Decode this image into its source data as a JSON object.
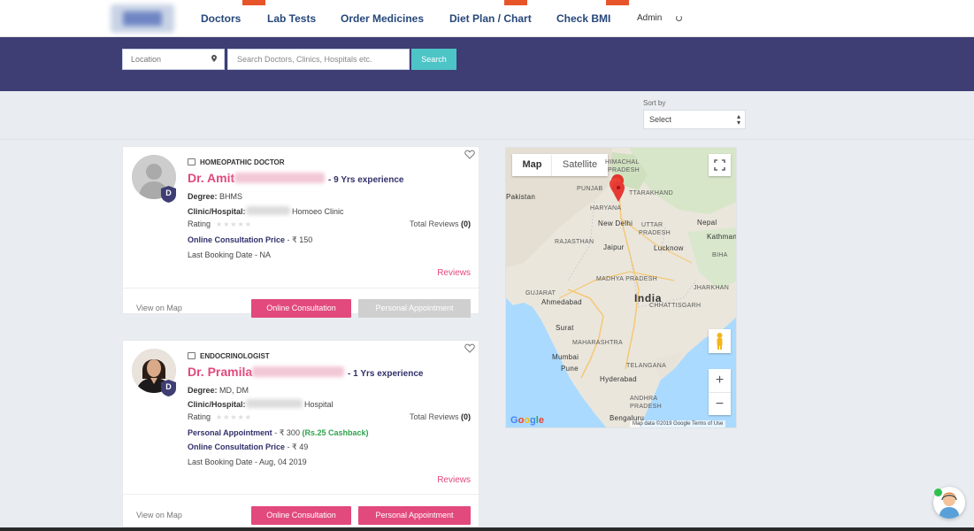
{
  "nav": {
    "links": [
      "Doctors",
      "Lab Tests",
      "Order Medicines",
      "Diet Plan / Chart",
      "Check BMI"
    ],
    "user_label": "Admin"
  },
  "search": {
    "location_placeholder": "Location",
    "query_placeholder": "Search Doctors, Clinics, Hospitals etc.",
    "button_label": "Search"
  },
  "sort": {
    "label": "Sort by",
    "selected": "Select"
  },
  "doctors": [
    {
      "specialty": "HOMEOPATHIC DOCTOR",
      "name_first": "Dr. Amit",
      "experience": "- 9 Yrs experience",
      "degree_label": "Degree:",
      "degree": "BHMS",
      "clinic_label": "Clinic/Hospital:",
      "clinic": "Homoeo Clinic",
      "rating_label": "Rating",
      "total_reviews_label": "Total Reviews",
      "total_reviews": "(0)",
      "online_price_label": "Online Consultation Price",
      "online_price": "- ₹ 150",
      "last_booking": "Last Booking Date - NA",
      "reviews_link": "Reviews",
      "view_map": "View on Map",
      "btn_online": "Online Consultation",
      "btn_personal": "Personal Appointment"
    },
    {
      "specialty": "ENDOCRINOLOGIST",
      "name_first": "Dr. Pramila",
      "experience": "- 1 Yrs experience",
      "degree_label": "Degree:",
      "degree": "MD, DM",
      "clinic_label": "Clinic/Hospital:",
      "clinic": "Hospital",
      "rating_label": "Rating",
      "total_reviews_label": "Total Reviews",
      "total_reviews": "(0)",
      "personal_label": "Personal Appointment",
      "personal_price": "- ₹ 300",
      "cashback": "(Rs.25 Cashback)",
      "online_price_label": "Online Consultation Price",
      "online_price": "- ₹ 49",
      "last_booking": "Last Booking Date - Aug, 04 2019",
      "reviews_link": "Reviews",
      "view_map": "View on Map",
      "btn_online": "Online Consultation",
      "btn_personal": "Personal Appointment"
    }
  ],
  "map": {
    "tab_map": "Map",
    "tab_satellite": "Satellite",
    "labels": {
      "pakistan": "Pakistan",
      "punjab": "PUNJAB",
      "himachal": "HIMACHAL",
      "pradesh1": "PRADESH",
      "uttarakhand": "TTARAKHAND",
      "haryana": "HARYANA",
      "new_delhi": "New Delhi",
      "nepal": "Nepal",
      "uttar": "UTTAR",
      "pradesh2": "PRADESH",
      "kathmandu": "Kathman",
      "jaipur": "Jaipur",
      "rajasthan": "RAJASTHAN",
      "lucknow": "Lucknow",
      "bihar": "BIHA",
      "gujarat": "GUJARAT",
      "ahmedabad": "Ahmedabad",
      "madhya": "MADHYA PRADESH",
      "india": "India",
      "jharkhand": "JHARKHAN",
      "chhattisgarh": "CHHATTISGARH",
      "surat": "Surat",
      "maharashtra": "MAHARASHTRA",
      "mumbai": "Mumbai",
      "pune": "Pune",
      "telangana": "TELANGANA",
      "hyderabad": "Hyderabad",
      "andhra": "ANDHRA",
      "pradesh3": "PRADESH",
      "bengaluru": "Bengaluru"
    },
    "google": "Google",
    "footer": "Map data ©2019 Google   Terms of Use",
    "zoom_in": "+",
    "zoom_out": "−"
  },
  "colors": {
    "nav_text": "#26477a",
    "band": "#3e3d74",
    "accent_pink": "#e2497c",
    "search_btn": "#4dc4c6",
    "cashback": "#2fa34b"
  }
}
